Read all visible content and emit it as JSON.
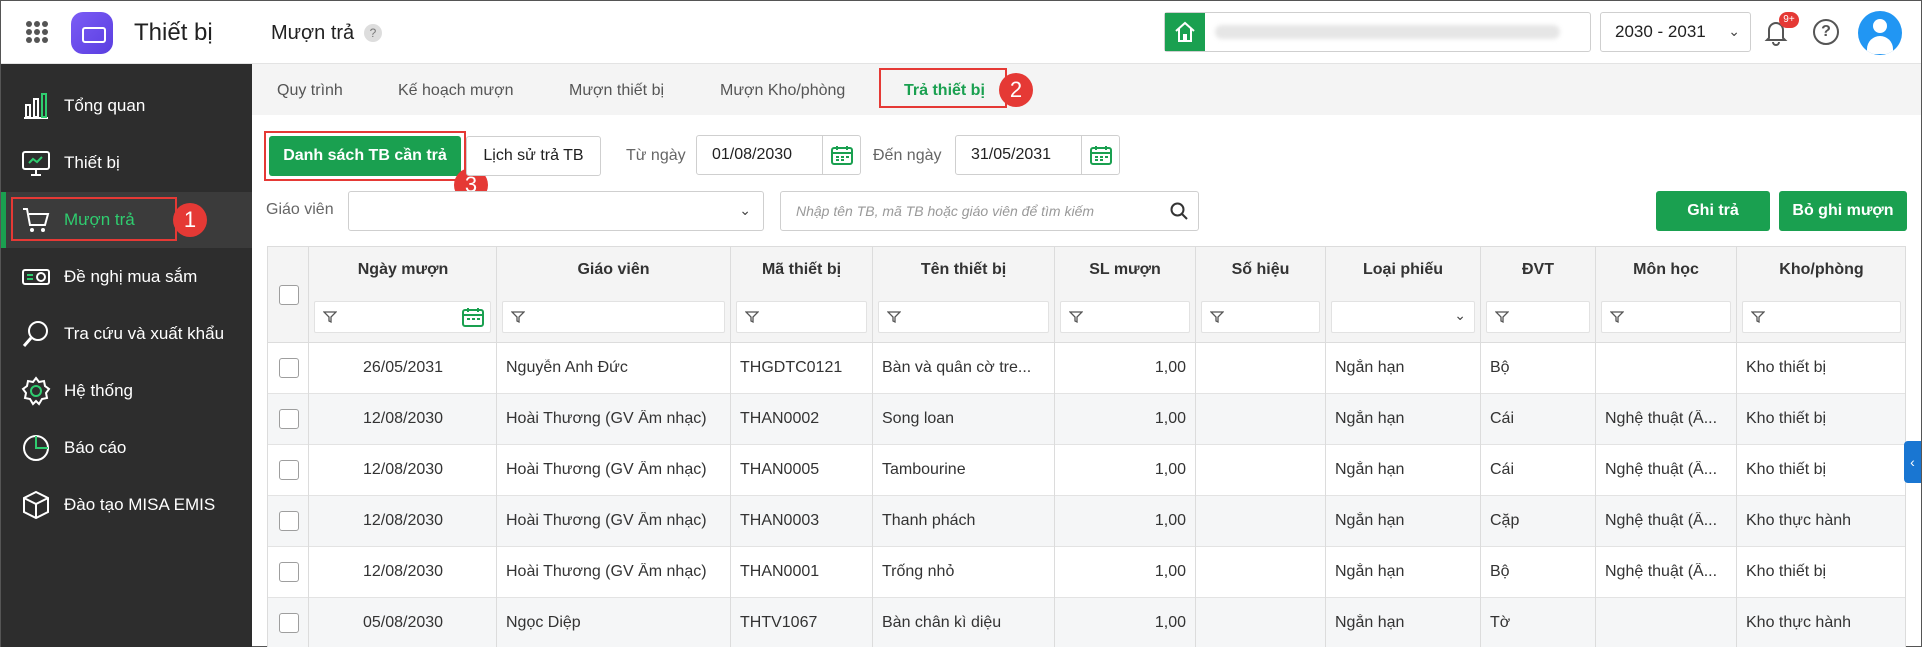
{
  "header": {
    "app_title": "Thiết bị",
    "page_title": "Mượn trả",
    "help_mark": "?",
    "school_year": "2030 - 2031",
    "notif_badge": "9+",
    "help_label": "?"
  },
  "sidebar": {
    "items": [
      {
        "label": "Tổng quan",
        "icon": "chart-bars-icon"
      },
      {
        "label": "Thiết bị",
        "icon": "monitor-icon"
      },
      {
        "label": "Mượn trả",
        "icon": "cart-icon",
        "active": true
      },
      {
        "label": "Đề nghị mua sắm",
        "icon": "projector-icon"
      },
      {
        "label": "Tra cứu và xuất khẩu",
        "icon": "search-icon"
      },
      {
        "label": "Hệ thống",
        "icon": "gear-icon"
      },
      {
        "label": "Báo cáo",
        "icon": "pie-chart-icon"
      },
      {
        "label": "Đào tạo MISA EMIS",
        "icon": "cube-icon"
      }
    ]
  },
  "tabs": [
    "Quy trình",
    "Kế hoạch mượn",
    "Mượn thiết bị",
    "Mượn Kho/phòng",
    "Trả thiết bị"
  ],
  "active_tab": "Trả thiết bị",
  "filters": {
    "list_button": "Danh sách TB cần trả",
    "history_button": "Lịch sử trả TB",
    "from_label": "Từ ngày",
    "from_value": "01/08/2030",
    "to_label": "Đến ngày",
    "to_value": "31/05/2031",
    "teacher_label": "Giáo viên",
    "search_placeholder": "Nhập tên TB, mã TB hoặc giáo viên để tìm kiếm",
    "record_button": "Ghi trả",
    "cancel_button": "Bỏ ghi mượn"
  },
  "annotations": [
    "1",
    "2",
    "3"
  ],
  "table": {
    "columns": [
      "Ngày mượn",
      "Giáo viên",
      "Mã thiết bị",
      "Tên thiết bị",
      "SL mượn",
      "Số hiệu",
      "Loại phiếu",
      "ĐVT",
      "Môn học",
      "Kho/phòng"
    ],
    "rows": [
      [
        "26/05/2031",
        "Nguyễn Anh Đức",
        "THGDTC0121",
        "Bàn và quân cờ tre...",
        "1,00",
        "",
        "Ngắn hạn",
        "Bộ",
        "",
        "Kho thiết bị"
      ],
      [
        "12/08/2030",
        "Hoài Thương (GV Âm nhạc)",
        "THAN0002",
        "Song loan",
        "1,00",
        "",
        "Ngắn hạn",
        "Cái",
        "Nghệ thuật (Â...",
        "Kho thiết bị"
      ],
      [
        "12/08/2030",
        "Hoài Thương (GV Âm nhạc)",
        "THAN0005",
        "Tambourine",
        "1,00",
        "",
        "Ngắn hạn",
        "Cái",
        "Nghệ thuật (Â...",
        "Kho thiết bị"
      ],
      [
        "12/08/2030",
        "Hoài Thương (GV Âm nhạc)",
        "THAN0003",
        "Thanh phách",
        "1,00",
        "",
        "Ngắn hạn",
        "Cặp",
        "Nghệ thuật (Â...",
        "Kho thực hành"
      ],
      [
        "12/08/2030",
        "Hoài Thương (GV Âm nhạc)",
        "THAN0001",
        "Trống nhỏ",
        "1,00",
        "",
        "Ngắn hạn",
        "Bộ",
        "Nghệ thuật (Â...",
        "Kho thiết bị"
      ],
      [
        "05/08/2030",
        "Ngọc Diệp",
        "THTV1067",
        "Bàn chân kì diệu",
        "1,00",
        "",
        "Ngắn hạn",
        "Tờ",
        "",
        "Kho thực hành"
      ]
    ]
  },
  "colors": {
    "accent": "#1aa050",
    "sidebar": "#2d2d2d",
    "annotation": "#e53935"
  }
}
